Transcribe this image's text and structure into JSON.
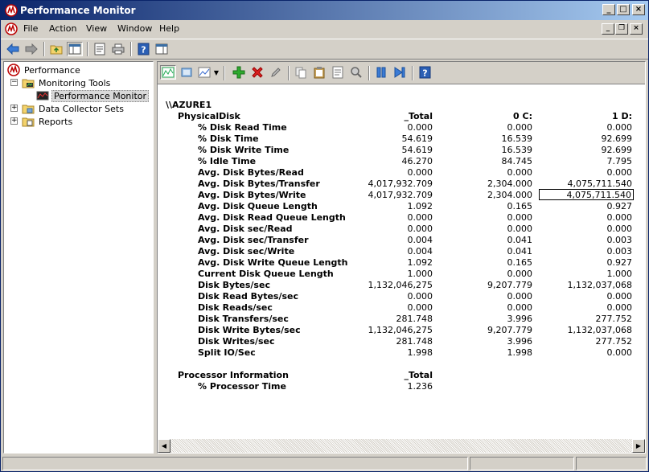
{
  "window": {
    "title": "Performance Monitor"
  },
  "menu": {
    "items": [
      "File",
      "Action",
      "View",
      "Window",
      "Help"
    ]
  },
  "tree": {
    "root": "Performance",
    "monitoring_tools": "Monitoring Tools",
    "performance_monitor": "Performance Monitor",
    "data_collector_sets": "Data Collector Sets",
    "reports": "Reports"
  },
  "report": {
    "machine": "\\\\AZURE1",
    "physical_disk": {
      "object": "PhysicalDisk",
      "columns": [
        "_Total",
        "0 C:",
        "1 D:"
      ],
      "rows": [
        {
          "counter": "% Disk Read Time",
          "values": [
            "0.000",
            "0.000",
            "0.000"
          ]
        },
        {
          "counter": "% Disk Time",
          "values": [
            "54.619",
            "16.539",
            "92.699"
          ]
        },
        {
          "counter": "% Disk Write Time",
          "values": [
            "54.619",
            "16.539",
            "92.699"
          ]
        },
        {
          "counter": "% Idle Time",
          "values": [
            "46.270",
            "84.745",
            "7.795"
          ]
        },
        {
          "counter": "Avg. Disk Bytes/Read",
          "values": [
            "0.000",
            "0.000",
            "0.000"
          ]
        },
        {
          "counter": "Avg. Disk Bytes/Transfer",
          "values": [
            "4,017,932.709",
            "2,304.000",
            "4,075,711.540"
          ]
        },
        {
          "counter": "Avg. Disk Bytes/Write",
          "values": [
            "4,017,932.709",
            "2,304.000",
            "4,075,711.540"
          ]
        },
        {
          "counter": "Avg. Disk Queue Length",
          "values": [
            "1.092",
            "0.165",
            "0.927"
          ]
        },
        {
          "counter": "Avg. Disk Read Queue Length",
          "values": [
            "0.000",
            "0.000",
            "0.000"
          ]
        },
        {
          "counter": "Avg. Disk sec/Read",
          "values": [
            "0.000",
            "0.000",
            "0.000"
          ]
        },
        {
          "counter": "Avg. Disk sec/Transfer",
          "values": [
            "0.004",
            "0.041",
            "0.003"
          ]
        },
        {
          "counter": "Avg. Disk sec/Write",
          "values": [
            "0.004",
            "0.041",
            "0.003"
          ]
        },
        {
          "counter": "Avg. Disk Write Queue Length",
          "values": [
            "1.092",
            "0.165",
            "0.927"
          ]
        },
        {
          "counter": "Current Disk Queue Length",
          "values": [
            "1.000",
            "0.000",
            "1.000"
          ]
        },
        {
          "counter": "Disk Bytes/sec",
          "values": [
            "1,132,046,275",
            "9,207.779",
            "1,132,037,068"
          ]
        },
        {
          "counter": "Disk Read Bytes/sec",
          "values": [
            "0.000",
            "0.000",
            "0.000"
          ]
        },
        {
          "counter": "Disk Reads/sec",
          "values": [
            "0.000",
            "0.000",
            "0.000"
          ]
        },
        {
          "counter": "Disk Transfers/sec",
          "values": [
            "281.748",
            "3.996",
            "277.752"
          ]
        },
        {
          "counter": "Disk Write Bytes/sec",
          "values": [
            "1,132,046,275",
            "9,207.779",
            "1,132,037,068"
          ]
        },
        {
          "counter": "Disk Writes/sec",
          "values": [
            "281.748",
            "3.996",
            "277.752"
          ]
        },
        {
          "counter": "Split IO/Sec",
          "values": [
            "1.998",
            "1.998",
            "0.000"
          ]
        }
      ]
    },
    "processor": {
      "object": "Processor Information",
      "columns": [
        "_Total"
      ],
      "rows": [
        {
          "counter": "% Processor Time",
          "values": [
            "1.236"
          ]
        }
      ]
    }
  },
  "colors": {
    "titlebar_start": "#0a246a",
    "titlebar_end": "#a6caf0",
    "chrome": "#d4d0c8"
  }
}
